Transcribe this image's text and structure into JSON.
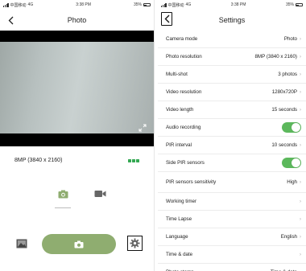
{
  "left": {
    "status": {
      "carrier": "中国移动",
      "network": "4G",
      "time": "3:38 PM",
      "battery": "35%"
    },
    "title": "Photo",
    "resolution": "8MP (3840 x 2160)",
    "icons": {
      "back": "chevron-left-icon",
      "expand": "expand-icon",
      "photo_mode": "camera-icon",
      "video_mode": "video-camera-icon",
      "gallery": "gallery-icon",
      "shutter": "camera-icon",
      "settings": "gear-icon"
    },
    "colors": {
      "accent_green": "#8fad70",
      "signal_green": "#34a853"
    }
  },
  "right": {
    "status": {
      "carrier": "中国移动",
      "network": "4G",
      "time": "3:38 PM",
      "battery": "35%"
    },
    "title": "Settings",
    "items": [
      {
        "label": "Camera mode",
        "value": "Photo"
      },
      {
        "label": "Photo resolution",
        "value": "8MP (3840 x 2160)"
      },
      {
        "label": "Multi-shot",
        "value": "3 photos"
      },
      {
        "label": "Video resolution",
        "value": "1280x720P"
      },
      {
        "label": "Video length",
        "value": "15 seconds"
      },
      {
        "label": "Audio recording",
        "toggle": true
      },
      {
        "label": "PIR interval",
        "value": "10 seconds"
      },
      {
        "label": "Side PIR sensors",
        "toggle": true
      },
      {
        "label": "PIR sensors sensitivity",
        "value": "High"
      },
      {
        "label": "Working timer",
        "value": ""
      },
      {
        "label": "Time Lapse",
        "value": ""
      },
      {
        "label": "Language",
        "value": "English"
      },
      {
        "label": "Time & date",
        "value": ""
      },
      {
        "label": "Photo stamp",
        "value": "Time & date"
      }
    ],
    "colors": {
      "toggle_on": "#5cb85c"
    }
  }
}
